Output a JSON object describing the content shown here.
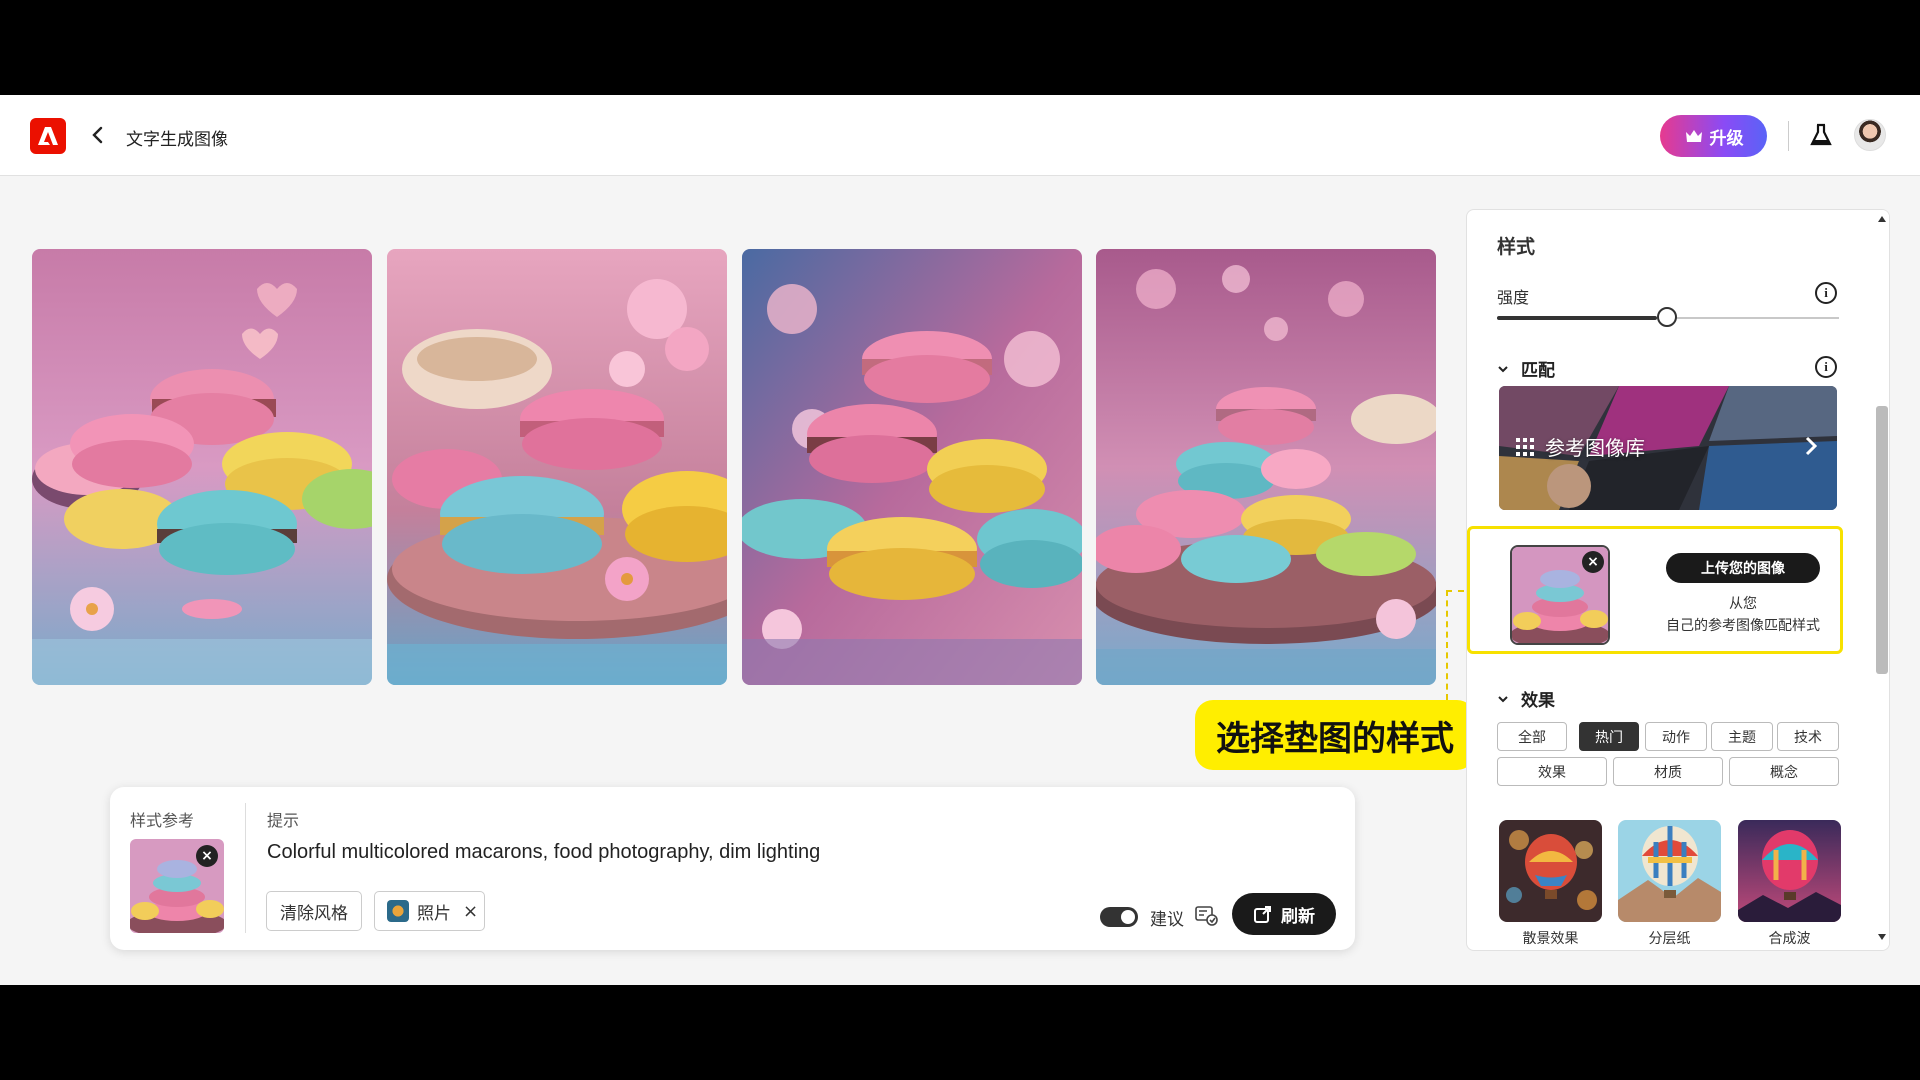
{
  "header": {
    "title": "文字生成图像",
    "upgrade_label": "升级"
  },
  "prompt_panel": {
    "style_ref_label": "样式参考",
    "prompt_label": "提示",
    "prompt_text": "Colorful multicolored macarons, food photography, dim lighting",
    "clear_style_label": "清除风格",
    "photo_tag_label": "照片",
    "suggest_label": "建议",
    "suggest_toggle_on": true,
    "refresh_label": "刷新"
  },
  "annotation": {
    "callout_text": "选择垫图的样式"
  },
  "right_panel": {
    "title": "样式",
    "strength_label": "强度",
    "strength_level": 0.5,
    "match_label": "匹配",
    "reference_gallery_label": "参考图像库",
    "upload_button_label": "上传您的图像",
    "upload_desc_line1": "从您",
    "upload_desc_line2": "自己的参考图像匹配样式",
    "effects_label": "效果",
    "effect_chips_row1": [
      "全部",
      "热门",
      "动作",
      "主题",
      "技术"
    ],
    "effect_chips_row2": [
      "效果",
      "材质",
      "概念"
    ],
    "active_chip": "热门",
    "effect_tiles": [
      "散景效果",
      "分层纸",
      "合成波"
    ]
  },
  "colors": {
    "brand_red": "#eb1000",
    "highlight_yellow": "#ffee00",
    "dark_button": "#1a1a1a"
  },
  "icons": {
    "back": "chevron-left-icon",
    "lab": "flask-icon",
    "info": "info-icon",
    "grid": "grid-icon",
    "refresh": "refresh-icon"
  }
}
